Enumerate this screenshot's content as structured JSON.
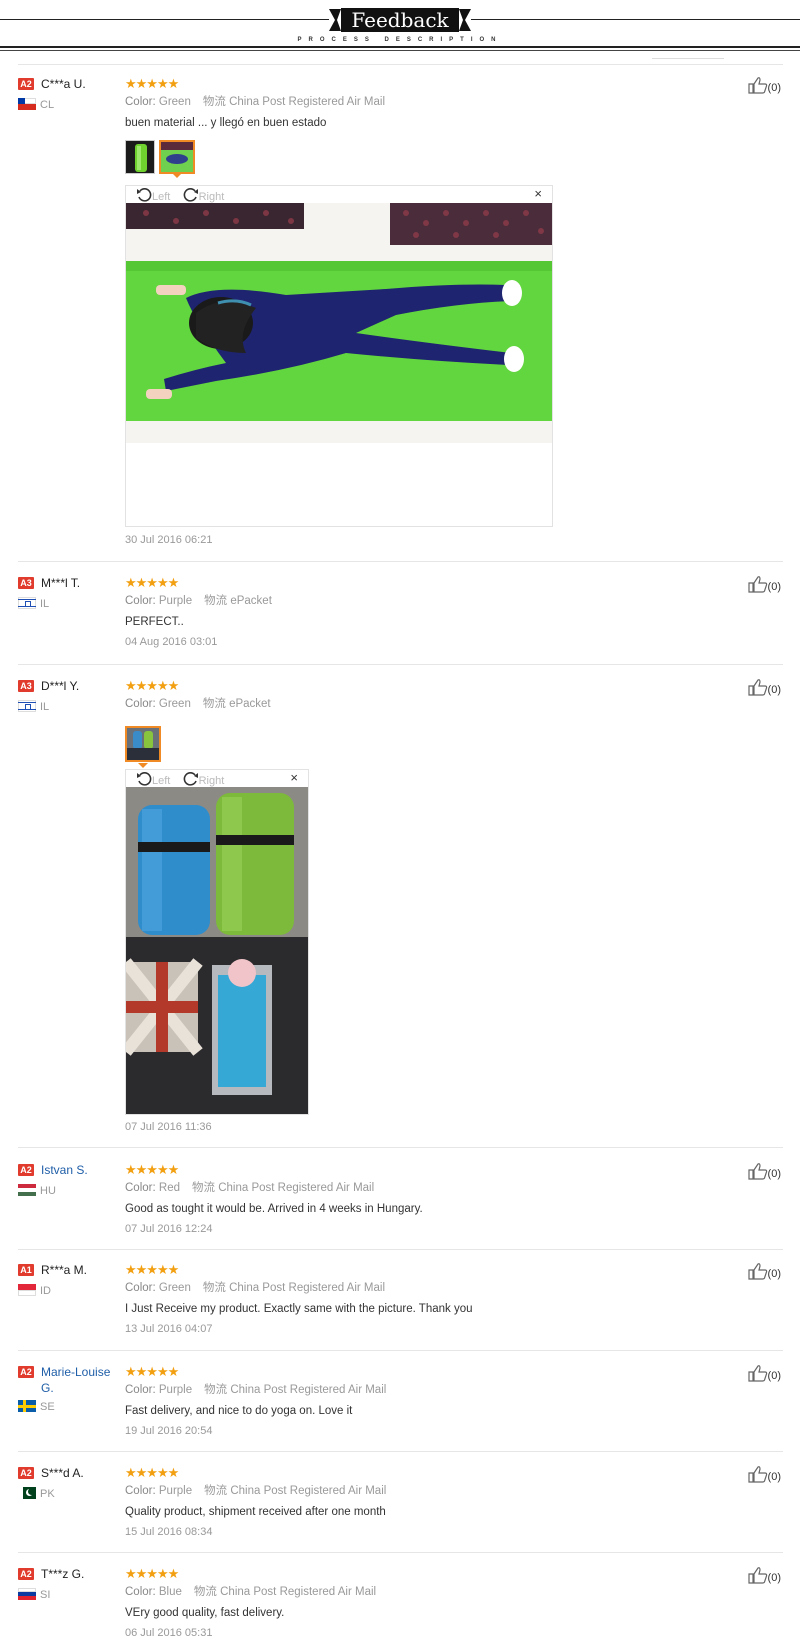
{
  "header": {
    "title": "Feedback",
    "subtitle": "PROCESS DESCRIPTION"
  },
  "viewer": {
    "rotate_left": "Left",
    "rotate_right": "Right",
    "close": "×"
  },
  "reviews": [
    {
      "level": "A2",
      "name": "C***a U.",
      "country": "CL",
      "stars": "★★★★★",
      "color_label": "Color:",
      "color": "Green",
      "ship_label": "物流",
      "shipping": "China Post Registered Air Mail",
      "text": "buen material ... y llegó en buen estado",
      "date": "30 Jul 2016 06:21",
      "likes": "(0)"
    },
    {
      "level": "A3",
      "name": "M***l T.",
      "country": "IL",
      "stars": "★★★★★",
      "color_label": "Color:",
      "color": "Purple",
      "ship_label": "物流",
      "shipping": "ePacket",
      "text": "PERFECT..",
      "date": "04 Aug 2016 03:01",
      "likes": "(0)"
    },
    {
      "level": "A3",
      "name": "D***l Y.",
      "country": "IL",
      "stars": "★★★★★",
      "color_label": "Color:",
      "color": "Green",
      "ship_label": "物流",
      "shipping": "ePacket",
      "text": "",
      "date": "07 Jul 2016 11:36",
      "likes": "(0)"
    },
    {
      "level": "A2",
      "name": "Istvan S.",
      "country": "HU",
      "stars": "★★★★★",
      "color_label": "Color:",
      "color": "Red",
      "ship_label": "物流",
      "shipping": "China Post Registered Air Mail",
      "text": "Good as tought it would be. Arrived in 4 weeks in Hungary.",
      "date": "07 Jul 2016 12:24",
      "likes": "(0)"
    },
    {
      "level": "A1",
      "name": "R***a M.",
      "country": "ID",
      "stars": "★★★★★",
      "color_label": "Color:",
      "color": "Green",
      "ship_label": "物流",
      "shipping": "China Post Registered Air Mail",
      "text": "I Just Receive my product. Exactly same with the picture. Thank you",
      "date": "13 Jul 2016 04:07",
      "likes": "(0)"
    },
    {
      "level": "A2",
      "name": "Marie-Louise G.",
      "country": "SE",
      "stars": "★★★★★",
      "color_label": "Color:",
      "color": "Purple",
      "ship_label": "物流",
      "shipping": "China Post Registered Air Mail",
      "text": "Fast delivery, and nice to do yoga on. Love it",
      "date": "19 Jul 2016 20:54",
      "likes": "(0)"
    },
    {
      "level": "A2",
      "name": "S***d A.",
      "country": "PK",
      "stars": "★★★★★",
      "color_label": "Color:",
      "color": "Purple",
      "ship_label": "物流",
      "shipping": "China Post Registered Air Mail",
      "text": "Quality product, shipment received after one month",
      "date": "15 Jul 2016 08:34",
      "likes": "(0)"
    },
    {
      "level": "A2",
      "name": "T***z G.",
      "country": "SI",
      "stars": "★★★★★",
      "color_label": "Color:",
      "color": "Blue",
      "ship_label": "物流",
      "shipping": "China Post Registered Air Mail",
      "text": "VEry good quality, fast delivery.",
      "date": "06 Jul 2016 05:31",
      "likes": "(0)"
    }
  ]
}
